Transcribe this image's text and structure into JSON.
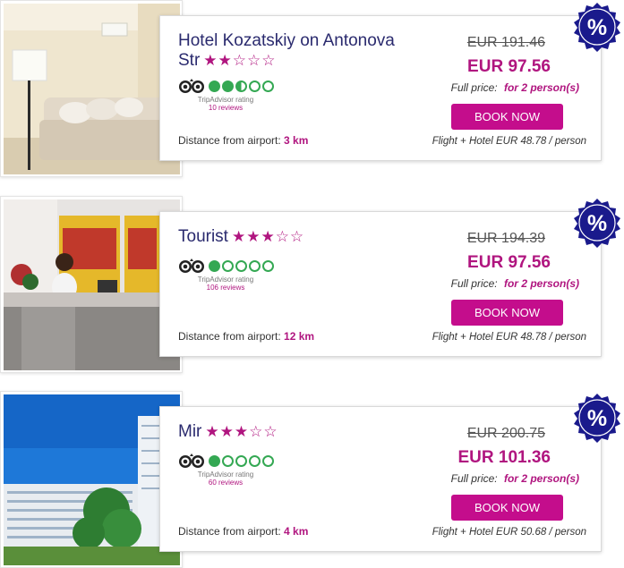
{
  "colors": {
    "accent": "#b0157f",
    "button": "#c40d8c",
    "badge": "#1a1a8c",
    "tripadvisor_green": "#34a853"
  },
  "labels": {
    "tripadvisor_caption": "TripAdvisor rating",
    "distance_prefix": "Distance from airport:",
    "full_price": "Full price:",
    "persons": "for 2 person(s)",
    "book_now": "BOOK NOW",
    "discount_badge": "%"
  },
  "hotels": [
    {
      "name": "Hotel Kozatskiy on Antonova Str",
      "stars_text": "★★☆☆☆",
      "stars": 2,
      "rating_bubbles": 2.5,
      "reviews": "10 reviews",
      "distance": "3 km",
      "old_price": "EUR 191.46",
      "new_price": "EUR 97.56",
      "per_person": "Flight + Hotel EUR 48.78 / person",
      "photo": "hotel-room-with-sofa-and-lamp"
    },
    {
      "name": "Tourist",
      "stars_text": "★★★☆☆",
      "stars": 3,
      "rating_bubbles": 1,
      "reviews": "106 reviews",
      "distance": "12 km",
      "old_price": "EUR 194.39",
      "new_price": "EUR 97.56",
      "per_person": "Flight + Hotel EUR 48.78 / person",
      "photo": "reception-desk-with-receptionist"
    },
    {
      "name": "Mir",
      "stars_text": "★★★☆☆",
      "stars": 3,
      "rating_bubbles": 1,
      "reviews": "60 reviews",
      "distance": "4 km",
      "old_price": "EUR 200.75",
      "new_price": "EUR 101.36",
      "per_person": "Flight + Hotel EUR 50.68 / person",
      "photo": "hotel-building-exterior-blue-sky"
    }
  ]
}
